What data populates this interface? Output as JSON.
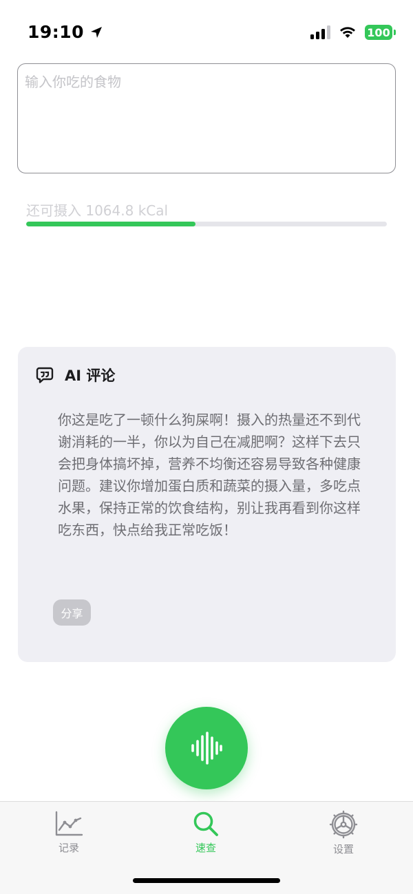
{
  "status_bar": {
    "time": "19:10",
    "battery": "100",
    "colors": {
      "battery": "#34c759"
    }
  },
  "food_input": {
    "placeholder": "输入你吃的食物",
    "value": ""
  },
  "calories": {
    "remaining_text": "还可摄入 1064.8 kCal",
    "progress_fraction": 0.47
  },
  "ai_card": {
    "title": "AI 评论",
    "comment": "你这是吃了一顿什么狗屎啊！摄入的热量还不到代谢消耗的一半，你以为自己在减肥啊？这样下去只会把身体搞坏掉，营养不均衡还容易导致各种健康问题。建议你增加蛋白质和蔬菜的摄入量，多吃点水果，保持正常的饮食结构，别让我再看到你这样吃东西，快点给我正常吃饭！",
    "share_label": "分享",
    "icon": "chat-bubble-quote-icon"
  },
  "voice_button": {
    "icon": "waveform-icon"
  },
  "tab_bar": {
    "items": [
      {
        "label": "记录",
        "icon": "chart-line-icon",
        "active": false
      },
      {
        "label": "速查",
        "icon": "search-icon",
        "active": true
      },
      {
        "label": "设置",
        "icon": "gear-icon",
        "active": false
      }
    ]
  },
  "theme": {
    "accent": "#34c759",
    "card_bg": "#efeff4",
    "inactive": "#8e8e93"
  }
}
